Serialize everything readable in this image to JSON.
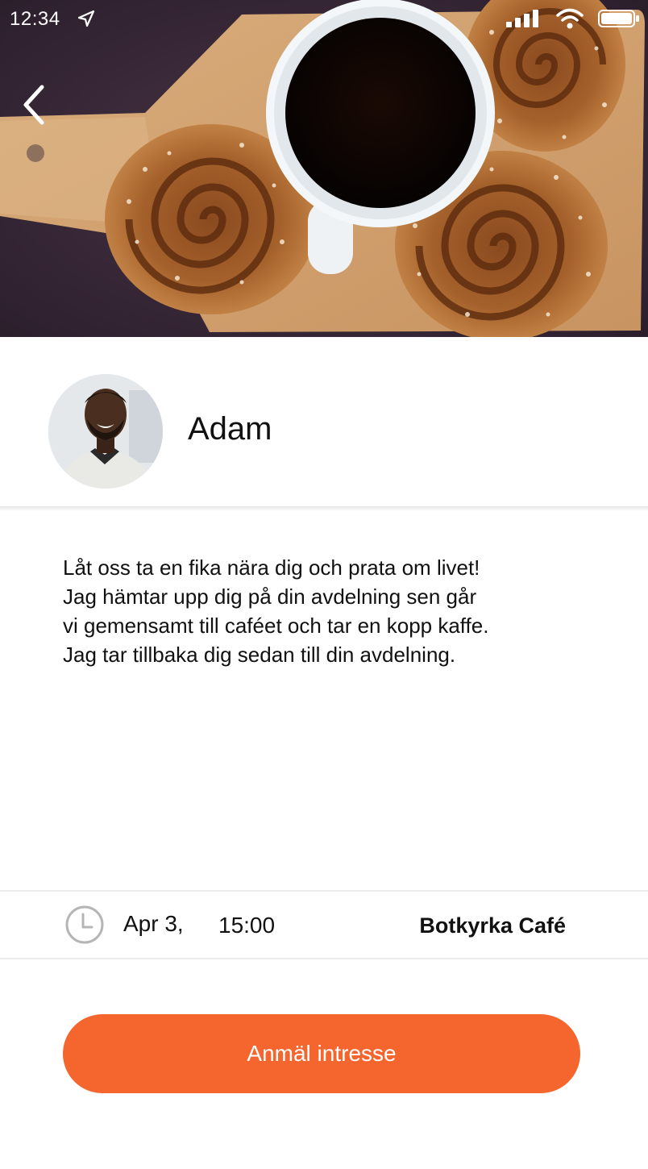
{
  "status_bar": {
    "time": "12:34",
    "location_icon": "location-arrow-icon",
    "signal_icon": "cellular-signal-icon",
    "wifi_icon": "wifi-icon",
    "battery_icon": "battery-icon"
  },
  "hero": {
    "image": "coffee-and-cinnamon-buns-photo",
    "back_icon": "chevron-left-icon"
  },
  "host": {
    "name": "Adam",
    "avatar": "host-avatar-photo"
  },
  "description": {
    "lines": [
      "Låt oss ta en fika nära dig och prata om livet!",
      "Jag hämtar upp dig på din avdelning sen går",
      "vi gemensamt till caféet och tar en kopp kaffe.",
      "Jag tar tillbaka dig sedan till din avdelning."
    ]
  },
  "event": {
    "icon": "clock-icon",
    "date": "Apr 3,",
    "time": "15:00",
    "location": "Botkyrka Café"
  },
  "cta": {
    "label": "Anmäl intresse"
  },
  "colors": {
    "accent": "#f5662e",
    "text": "#111111",
    "background": "#ffffff"
  }
}
